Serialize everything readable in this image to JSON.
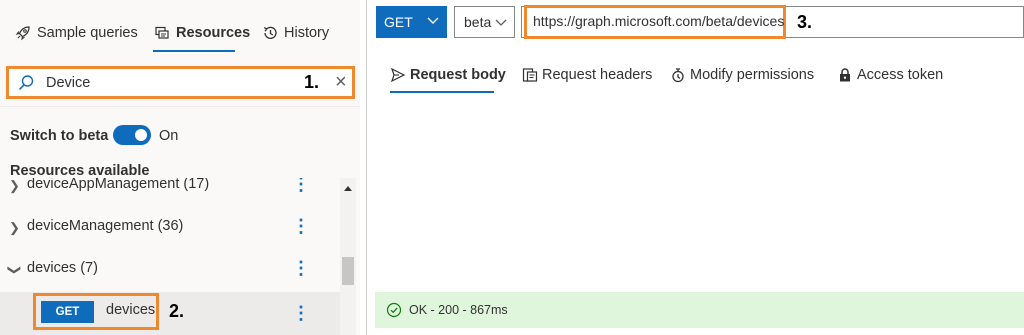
{
  "left_tabs": [
    {
      "label": "Sample queries",
      "icon": "rocket-icon"
    },
    {
      "label": "Resources",
      "icon": "resources-icon"
    },
    {
      "label": "History",
      "icon": "history-icon"
    }
  ],
  "search": {
    "value": "Device",
    "callout": "1.",
    "clear": "×"
  },
  "beta_toggle": {
    "label": "Switch to beta",
    "state": "On"
  },
  "resources": {
    "title": "Resources available",
    "items": [
      {
        "label": "deviceAppManagement (17)",
        "chevron": "›"
      },
      {
        "label": "deviceManagement (36)",
        "chevron": "›"
      },
      {
        "label": "devices (7)",
        "chevron": "‹"
      }
    ],
    "more_glyph": "⋮",
    "selected": {
      "method": "GET",
      "label": "devices",
      "callout": "2."
    }
  },
  "request": {
    "method": "GET",
    "version": "beta",
    "url": "https://graph.microsoft.com/beta/devices",
    "callout": "3."
  },
  "request_tabs": [
    {
      "label": "Request body",
      "icon": "send-icon"
    },
    {
      "label": "Request headers",
      "icon": "headers-icon"
    },
    {
      "label": "Modify permissions",
      "icon": "permissions-icon"
    },
    {
      "label": "Access token",
      "icon": "lock-icon"
    }
  ],
  "status": {
    "text": "OK - 200 - 867ms"
  },
  "colors": {
    "accent": "#0f6cbd",
    "callout_border": "#f0882e",
    "success_bg": "#dff6dd"
  }
}
